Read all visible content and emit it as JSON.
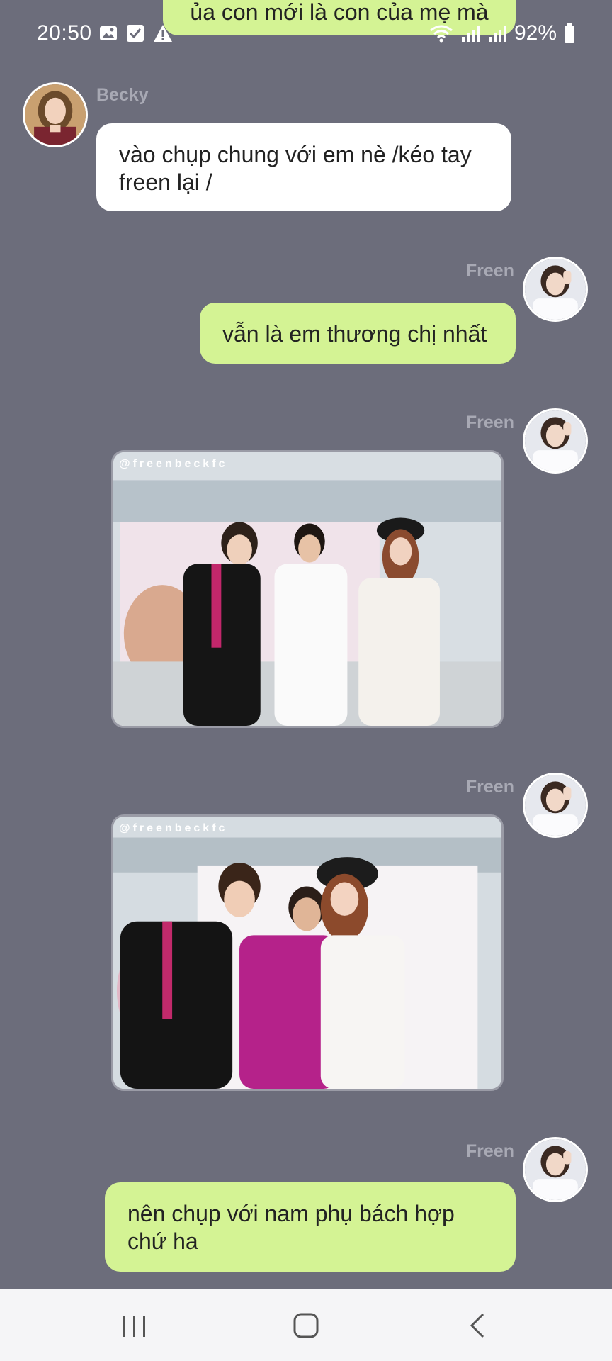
{
  "status": {
    "time": "20:50",
    "battery": "92%"
  },
  "messages": [
    {
      "type": "text",
      "side": "right",
      "text": "ủa con mới là con của mẹ mà"
    },
    {
      "type": "text",
      "side": "left",
      "sender": "Becky",
      "text": "vào chụp chung với em nè /kéo tay freen lại /"
    },
    {
      "type": "text",
      "side": "right",
      "sender": "Freen",
      "text": "vẫn là em thương chị nhất"
    },
    {
      "type": "image",
      "side": "right",
      "sender": "Freen",
      "watermark": "@freenbeckfc"
    },
    {
      "type": "image",
      "side": "right",
      "sender": "Freen",
      "watermark": "@freenbeckfc"
    },
    {
      "type": "text",
      "side": "right",
      "sender": "Freen",
      "text": "nên chụp với nam phụ bách hợp chứ ha"
    }
  ],
  "colors": {
    "background": "#6c6d7b",
    "green_bubble": "#d4f394",
    "white_bubble": "#ffffff"
  },
  "nav": {
    "icons": [
      "recent-apps-icon",
      "home-icon",
      "back-icon"
    ]
  }
}
